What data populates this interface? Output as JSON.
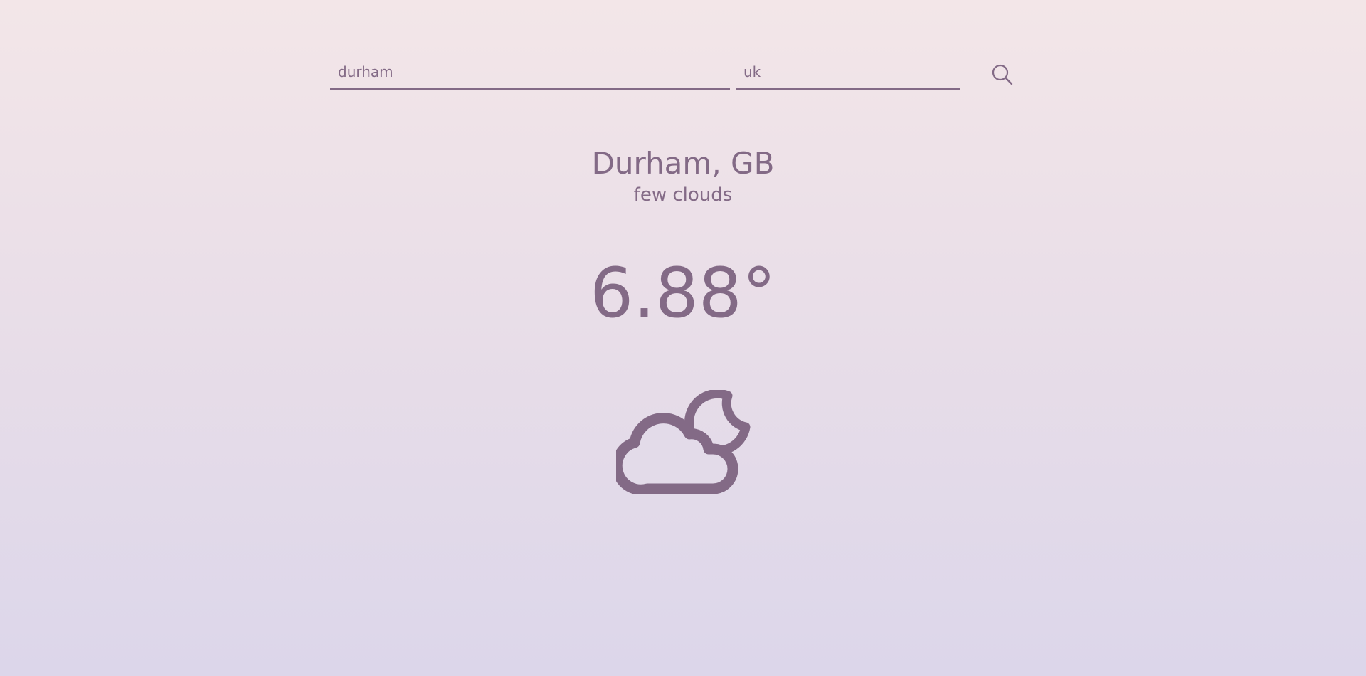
{
  "search": {
    "city_value": "durham",
    "country_value": "uk"
  },
  "weather": {
    "location": "Durham, GB",
    "description": "few clouds",
    "temperature": "6.88°",
    "icon": "cloud-moon-icon"
  },
  "colors": {
    "accent": "#836a86",
    "background_top": "#f3e6e8",
    "background_bottom": "#dcd6ea"
  }
}
